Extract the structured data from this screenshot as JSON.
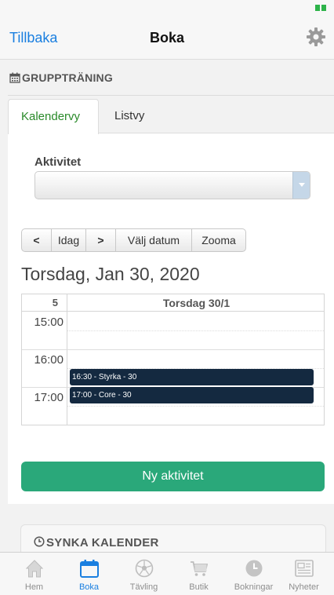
{
  "colors": {
    "accent": "#1a7fe0",
    "tab_active": "#2a8a2a",
    "primary_button": "#2aa87a",
    "event": "#142940"
  },
  "navbar": {
    "back_label": "Tillbaka",
    "title": "Boka",
    "settings_icon": "gear-icon"
  },
  "section": {
    "title": "GRUPPTRÄNING",
    "icon": "calendar-icon"
  },
  "tabs": [
    {
      "label": "Kalendervy",
      "active": true
    },
    {
      "label": "Listvy",
      "active": false
    }
  ],
  "filter": {
    "label": "Aktivitet",
    "selected": ""
  },
  "toolbar": {
    "prev": "<",
    "today": "Idag",
    "next": ">",
    "pick_date": "Välj datum",
    "zoom": "Zooma"
  },
  "date_title": "Torsdag, Jan 30, 2020",
  "calendar": {
    "week": "5",
    "day_header": "Torsdag 30/1",
    "times": [
      "15:00",
      "16:00",
      "17:00"
    ],
    "events": [
      {
        "label": "16:30 - Styrka - 30"
      },
      {
        "label": "17:00 - Core - 30"
      }
    ]
  },
  "new_activity_label": "Ny aktivitet",
  "sync": {
    "title": "SYNKA KALENDER",
    "icon": "clock-icon"
  },
  "tabbar": [
    {
      "label": "Hem",
      "icon": "home-icon",
      "active": false
    },
    {
      "label": "Boka",
      "icon": "calendar-icon",
      "active": true
    },
    {
      "label": "Tävling",
      "icon": "soccer-ball-icon",
      "active": false
    },
    {
      "label": "Butik",
      "icon": "cart-icon",
      "active": false
    },
    {
      "label": "Bokningar",
      "icon": "clock-icon",
      "active": false
    },
    {
      "label": "Nyheter",
      "icon": "newspaper-icon",
      "active": false
    }
  ]
}
